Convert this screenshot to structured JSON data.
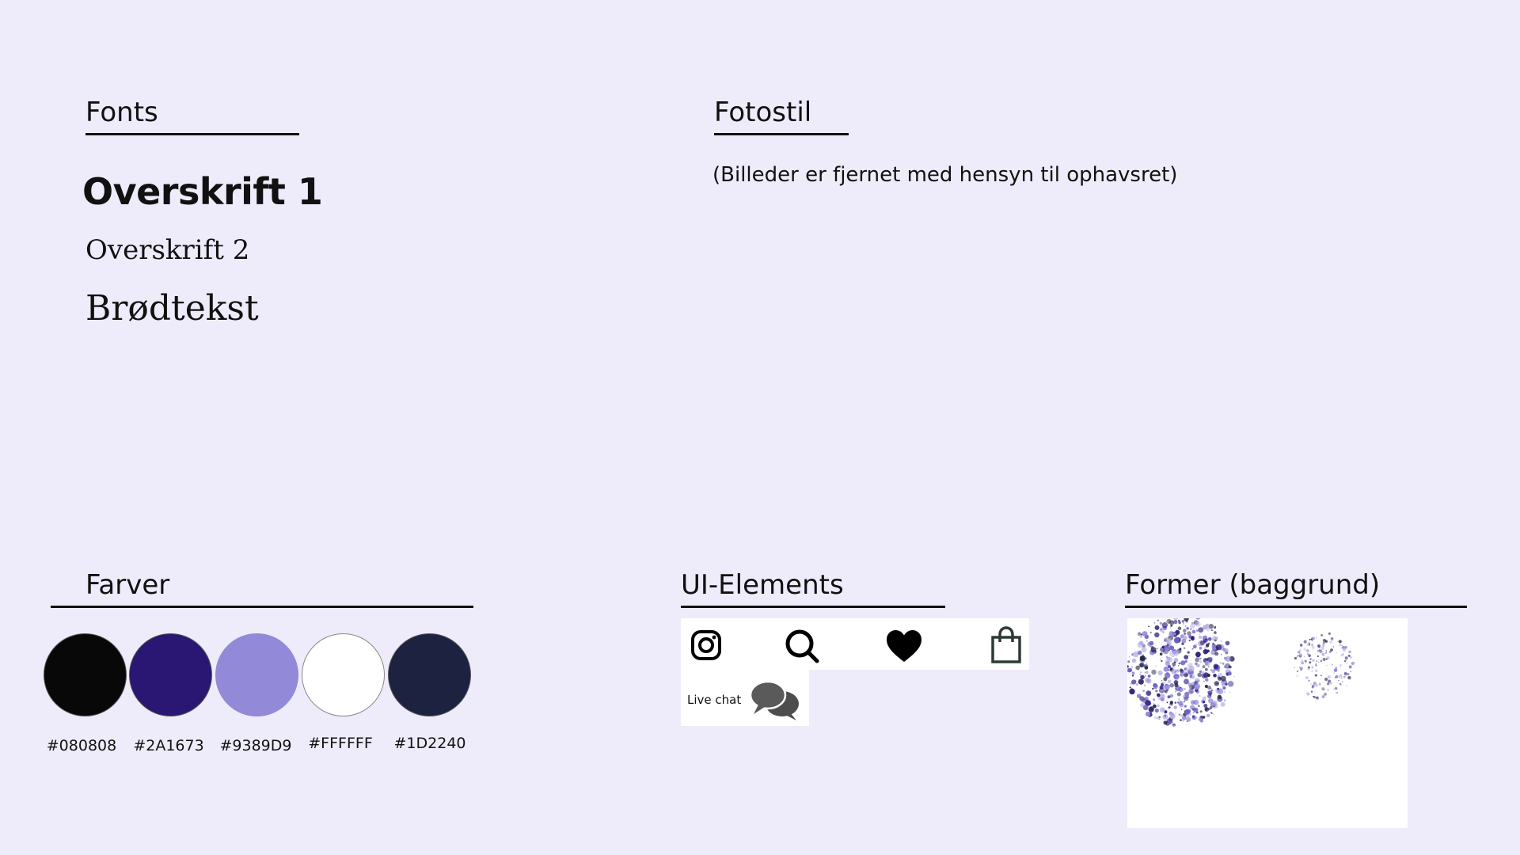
{
  "fonts": {
    "title": "Fonts",
    "heading1": "Overskrift 1",
    "heading2": "Overskrift 2",
    "body": "Brødtekst"
  },
  "photo_style": {
    "title": "Fotostil",
    "note": "(Billeder er fjernet med hensyn til ophavsret)"
  },
  "colors": {
    "title": "Farver",
    "swatches": [
      {
        "hex": "#080808",
        "label": "#080808"
      },
      {
        "hex": "#2A1673",
        "label": "#2A1673"
      },
      {
        "hex": "#9389D9",
        "label": "#9389D9"
      },
      {
        "hex": "#FFFFFF",
        "label": "#FFFFFF"
      },
      {
        "hex": "#1D2240",
        "label": "#1D2240"
      }
    ]
  },
  "ui_elements": {
    "title": "UI-Elements",
    "icons": [
      "instagram-icon",
      "search-icon",
      "heart-icon",
      "shopping-bag-icon"
    ],
    "live_chat_label": "Live chat",
    "live_chat_icon": "chat-bubbles-icon"
  },
  "shapes": {
    "title": "Former (baggrund)"
  }
}
